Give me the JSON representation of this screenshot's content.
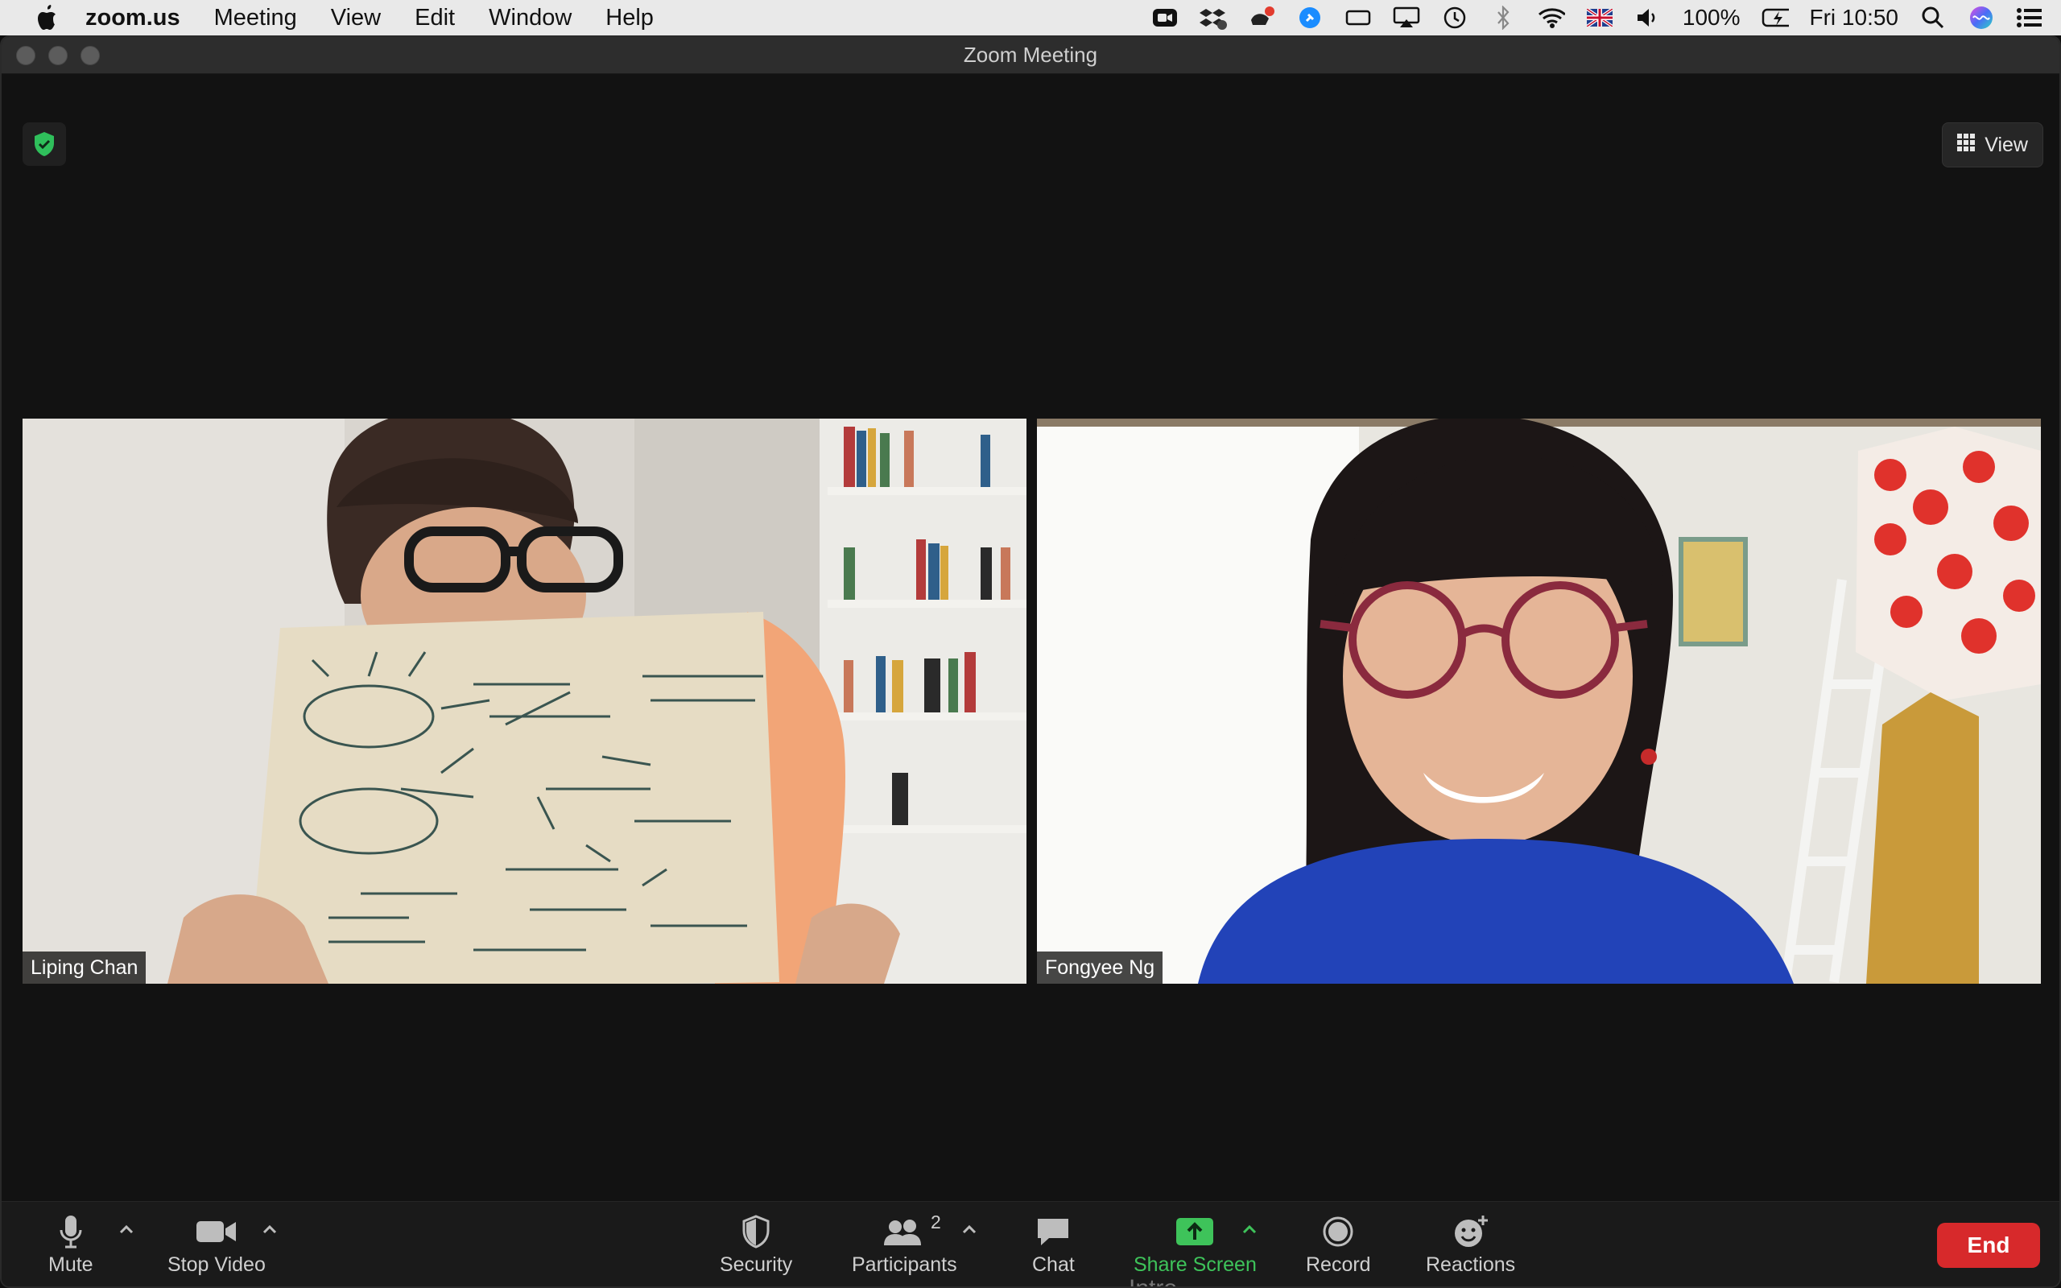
{
  "menubar": {
    "app_name": "zoom.us",
    "items": [
      "Meeting",
      "View",
      "Edit",
      "Window",
      "Help"
    ],
    "battery": "100%",
    "clock": "Fri 10:50"
  },
  "window": {
    "title": "Zoom Meeting"
  },
  "stage": {
    "view_label": "View",
    "participants": [
      {
        "name": "Liping Chan"
      },
      {
        "name": "Fongyee Ng"
      }
    ]
  },
  "toolbar": {
    "mute": "Mute",
    "stop_video": "Stop Video",
    "security": "Security",
    "participants": "Participants",
    "participants_count": "2",
    "chat": "Chat",
    "share_screen": "Share Screen",
    "record": "Record",
    "reactions": "Reactions",
    "end": "End",
    "behind_text": "Intro"
  },
  "colors": {
    "share_green": "#3ec35a",
    "end_red": "#d7292b",
    "shield_green": "#2fbf5b"
  }
}
